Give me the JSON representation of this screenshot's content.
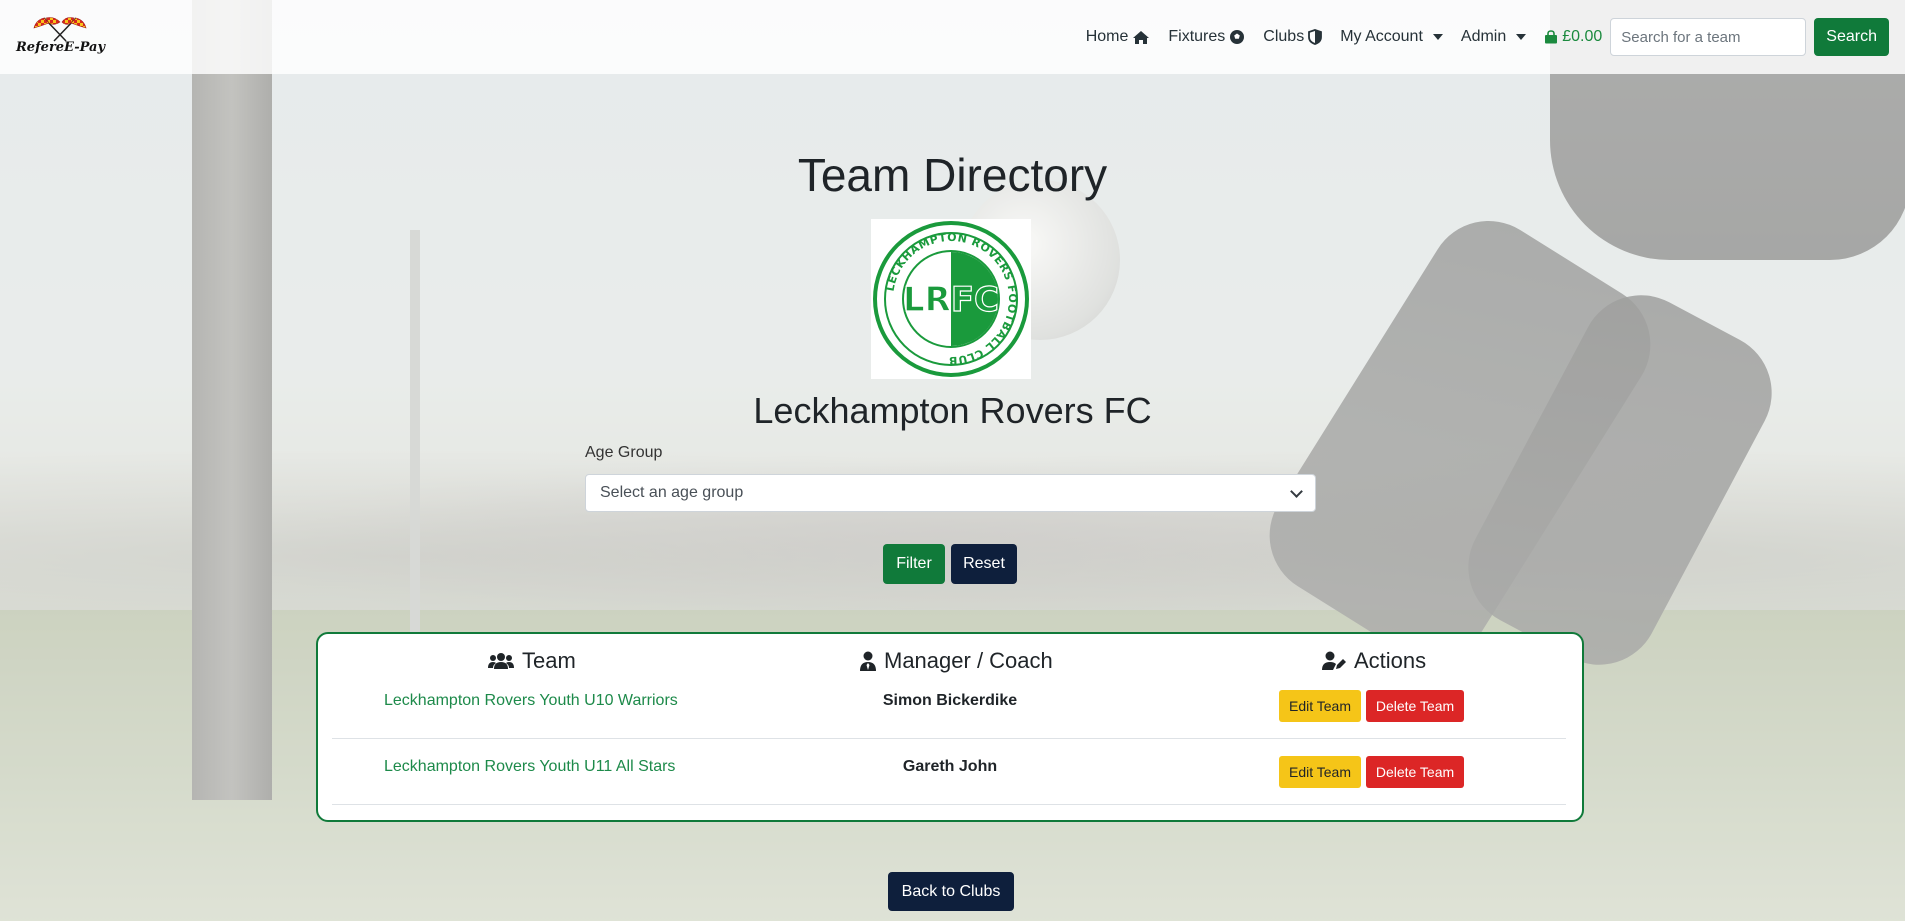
{
  "brand": {
    "name": "RefereE-Pay",
    "logo_icon": "checkered-flags-icon"
  },
  "nav": {
    "home": "Home",
    "fixtures": "Fixtures",
    "clubs": "Clubs",
    "my_account": "My Account",
    "admin": "Admin",
    "basket": "£0.00",
    "search_placeholder": "Search for a team",
    "search_button": "Search"
  },
  "page": {
    "title": "Team Directory",
    "club_name": "Leckhampton Rovers FC",
    "club_logo": {
      "initials": "LRFC",
      "ring_text": "LECKHAMPTON ROVERS FOOTBALL CLUB",
      "color": "#1a9a3c"
    }
  },
  "filter": {
    "age_group_label": "Age Group",
    "age_group_placeholder": "Select an age group",
    "filter_button": "Filter",
    "reset_button": "Reset"
  },
  "table": {
    "headers": {
      "team": "Team",
      "manager": "Manager / Coach",
      "actions": "Actions"
    },
    "rows": [
      {
        "team": "Leckhampton Rovers Youth U10 Warriors",
        "manager": "Simon Bickerdike",
        "edit": "Edit Team",
        "delete": "Delete Team"
      },
      {
        "team": "Leckhampton Rovers Youth U11 All Stars",
        "manager": "Gareth John",
        "edit": "Edit Team",
        "delete": "Delete Team"
      }
    ]
  },
  "footer": {
    "back_button": "Back to Clubs"
  },
  "colors": {
    "primary_green": "#107a3a",
    "navy": "#0e1f3c",
    "edit_yellow": "#f5c518",
    "delete_red": "#dc2626",
    "link_green": "#1d8a4a"
  }
}
